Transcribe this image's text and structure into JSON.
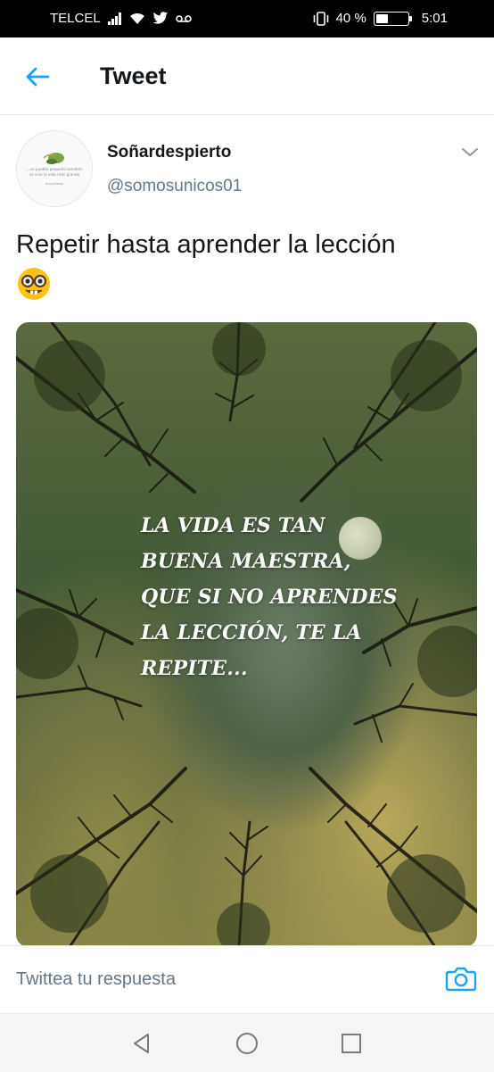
{
  "status_bar": {
    "carrier": "TELCEL",
    "battery_text": "40 %",
    "battery_level": 0.4,
    "time": "5:01",
    "icons": [
      "signal-icon",
      "wifi-icon",
      "twitter-bird-icon",
      "voicemail-icon",
      "vibrate-icon",
      "battery-icon"
    ]
  },
  "header": {
    "back_icon": "arrow-left-icon",
    "title": "Tweet"
  },
  "tweet": {
    "display_name": "Soñardespierto",
    "handle": "@somosunicos01",
    "text": "Repetir hasta aprender la lección",
    "emoji": "nerd-face-emoji",
    "more_icon": "chevron-down-icon",
    "avatar_caption": "...un pueblo pequeño también se vive la vida más grande",
    "avatar_signature": "#soyfelizasi",
    "media": {
      "lines": [
        "LA VIDA ES TAN",
        "BUENA MAESTRA,",
        "QUE SI NO APRENDES",
        "LA LECCIÓN, TE LA",
        "REPITE..."
      ]
    }
  },
  "reply": {
    "placeholder": "Twittea tu respuesta",
    "camera_icon": "camera-icon"
  },
  "nav": {
    "back_icon": "nav-back-icon",
    "home_icon": "nav-home-icon",
    "recents_icon": "nav-recents-icon"
  },
  "colors": {
    "accent": "#1da1f2",
    "text_primary": "#14171a",
    "text_secondary": "#657786",
    "divider": "#e1e8ed"
  }
}
